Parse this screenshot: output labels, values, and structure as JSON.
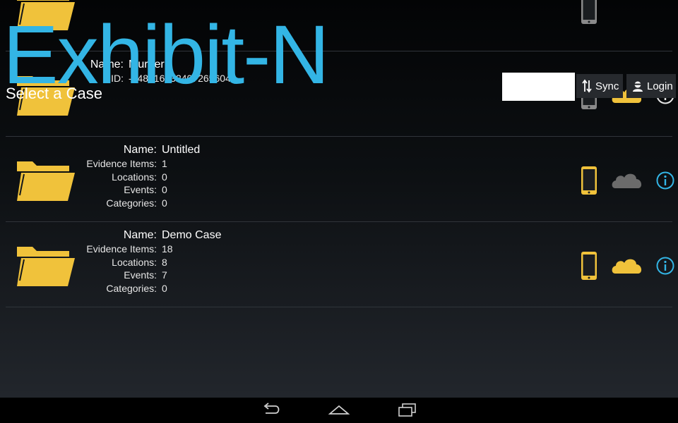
{
  "app": {
    "title": "Exhibit-N",
    "subtitle": "Select a Case"
  },
  "toolbar": {
    "sync_label": "Sync",
    "login_label": "Login"
  },
  "cases": [
    {
      "fields": [],
      "phone_color": "#8a8a8a"
    },
    {
      "fields": [
        {
          "key": "Name:",
          "value": "Murder"
        },
        {
          "key": "ID:",
          "value": "-8484160324072656046"
        }
      ],
      "phone_color": "#8a8a8a",
      "cloud_color": "#f0c23b",
      "info_color": "#e6e6e6"
    },
    {
      "fields": [
        {
          "key": "Name:",
          "value": "Untitled"
        },
        {
          "key": "Evidence Items:",
          "value": "1"
        },
        {
          "key": "Locations:",
          "value": "0"
        },
        {
          "key": "Events:",
          "value": "0"
        },
        {
          "key": "Categories:",
          "value": "0"
        }
      ],
      "phone_color": "#f0c23b",
      "cloud_color": "#6b6b6b",
      "info_color": "#33b5e5"
    },
    {
      "fields": [
        {
          "key": "Name:",
          "value": "Demo Case"
        },
        {
          "key": "Evidence Items:",
          "value": "18"
        },
        {
          "key": "Locations:",
          "value": "8"
        },
        {
          "key": "Events:",
          "value": "7"
        },
        {
          "key": "Categories:",
          "value": "0"
        }
      ],
      "phone_color": "#f0c23b",
      "cloud_color": "#f0c23b",
      "info_color": "#33b5e5"
    }
  ],
  "icons": {
    "folder": "folder-icon",
    "phone": "phone-icon",
    "cloud": "cloud-icon",
    "info": "info-icon",
    "sync": "sync-icon",
    "login": "user-icon",
    "back": "back-icon",
    "home": "home-icon",
    "recents": "recents-icon"
  },
  "colors": {
    "accent": "#33b5e5",
    "folder": "#f0c23b",
    "inactive": "#8a8a8a"
  }
}
